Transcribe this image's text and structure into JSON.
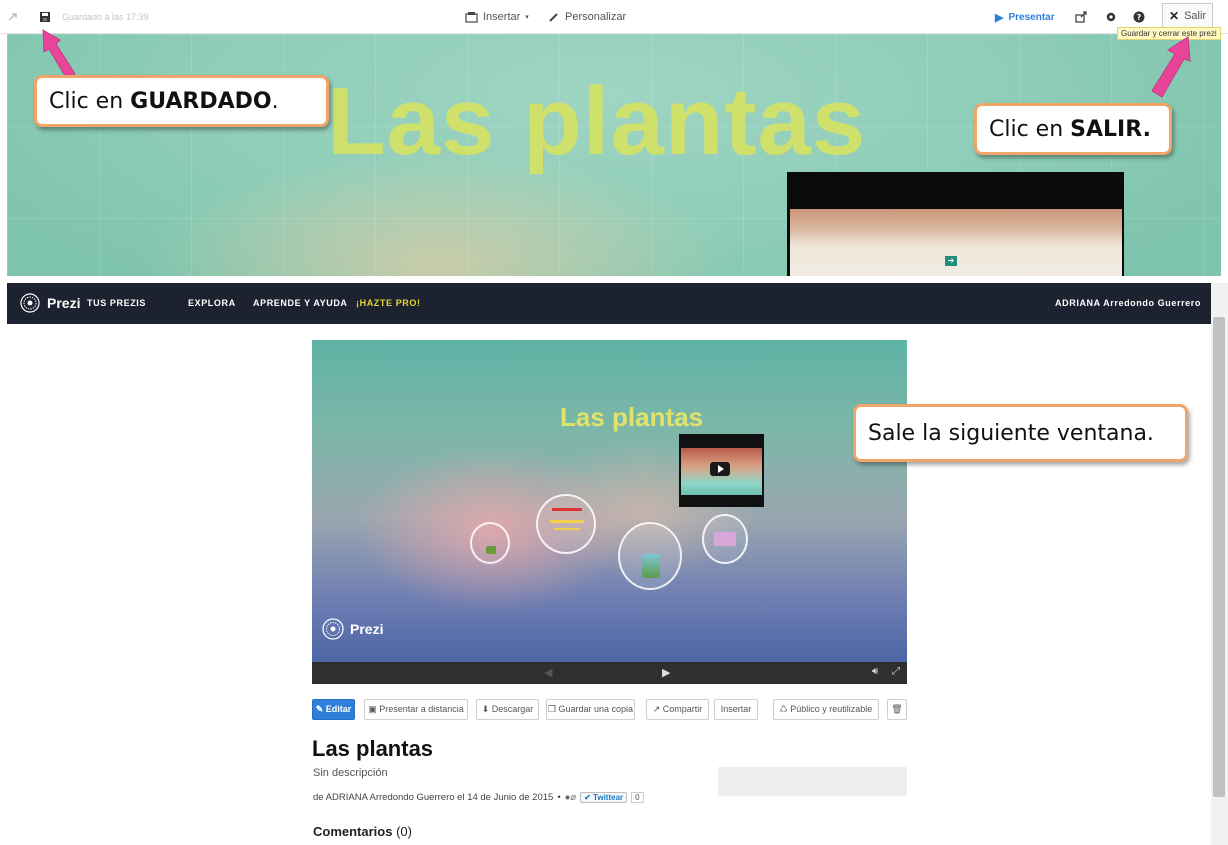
{
  "editor": {
    "toolbar": {
      "saved_text": "Guardado a las 17:39",
      "insert_label": "Insertar",
      "customize_label": "Personalizar",
      "present_label": "Presentar",
      "exit_label": "Salir",
      "exit_tooltip": "Guardar y cerrar este prezi"
    },
    "canvas_title": "Las plantas"
  },
  "callouts": {
    "guardado_prefix": "Clic en ",
    "guardado_bold": "GUARDADO",
    "guardado_suffix": ".",
    "salir_prefix": "Clic en ",
    "salir_bold": "SALIR.",
    "ventana": "Sale la siguiente ventana."
  },
  "site": {
    "logo": "Prezi",
    "nav": [
      "TUS PREZIS",
      "EXPLORA",
      "APRENDE Y AYUDA",
      "¡HAZTE PRO!"
    ],
    "user": "ADRIANA Arredondo Guerrero",
    "player_title": "Las plantas",
    "watermark": "Prezi",
    "buttons": {
      "edit": "Editar",
      "present_remote": "Presentar a distancia",
      "download": "Descargar",
      "save_copy": "Guardar una copia",
      "share": "Compartir",
      "insert": "Insertar",
      "public": "Público y reutilizable"
    },
    "title": "Las plantas",
    "description": "Sin descripción",
    "meta": "de ADRIANA Arredondo Guerrero el 14 de Junio de 2015",
    "twitter_label": "Twittear",
    "twitter_count": "0",
    "comments_label": "Comentarios",
    "comments_count": "(0)"
  },
  "colors": {
    "nav_bg": "#1c2230",
    "accent_yellow": "#e6d63a",
    "edit_blue": "#2e7fd9",
    "callout_border": "#f0a56a",
    "arrow_pink": "#e8459a"
  }
}
